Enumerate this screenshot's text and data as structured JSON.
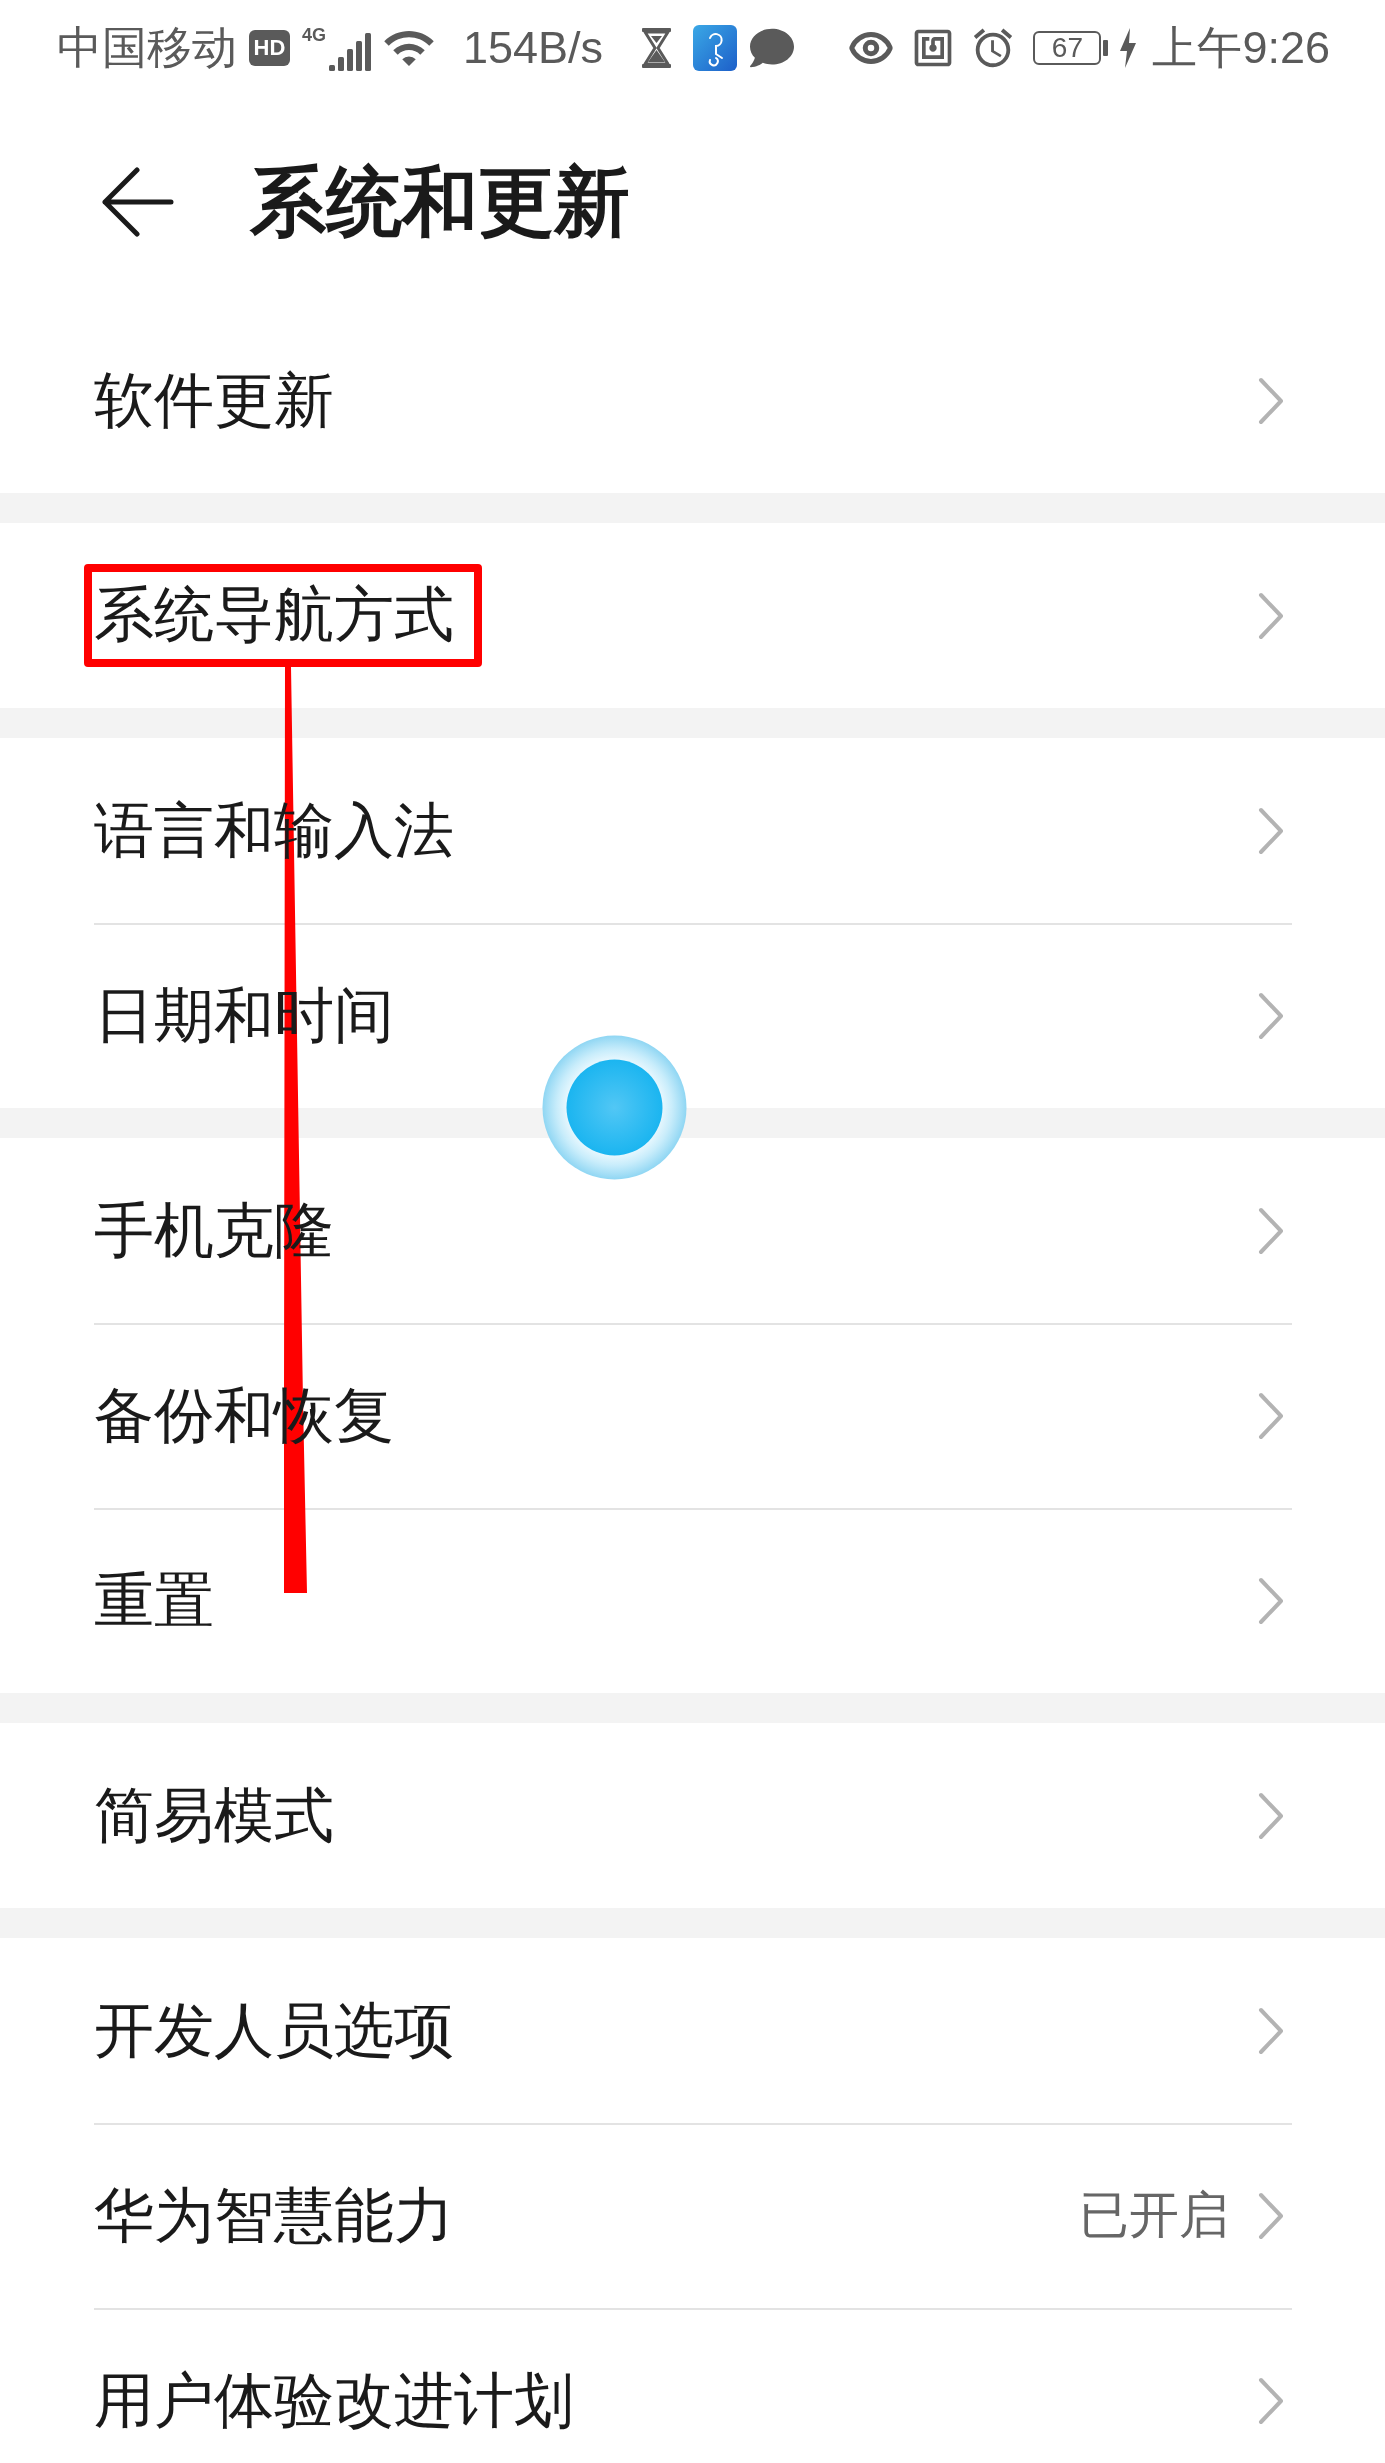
{
  "status_bar": {
    "carrier": "中国移动",
    "hd_badge": "HD",
    "network_type": "4G",
    "network_speed": "154B/s",
    "battery": "67",
    "time": "上午9:26"
  },
  "header": {
    "title": "系统和更新"
  },
  "sections": [
    {
      "items": [
        {
          "label": "软件更新",
          "highlighted": false
        }
      ]
    },
    {
      "items": [
        {
          "label": "系统导航方式",
          "highlighted": true
        }
      ]
    },
    {
      "items": [
        {
          "label": "语言和输入法",
          "highlighted": false
        },
        {
          "label": "日期和时间",
          "highlighted": false
        }
      ]
    },
    {
      "items": [
        {
          "label": "手机克隆",
          "highlighted": false
        },
        {
          "label": "备份和恢复",
          "highlighted": false
        },
        {
          "label": "重置",
          "highlighted": false
        }
      ]
    },
    {
      "items": [
        {
          "label": "简易模式",
          "highlighted": false
        }
      ]
    },
    {
      "items": [
        {
          "label": "开发人员选项",
          "highlighted": false
        },
        {
          "label": "华为智慧能力",
          "highlighted": false,
          "value": "已开启"
        },
        {
          "label": "用户体验改进计划",
          "highlighted": false
        }
      ]
    }
  ]
}
